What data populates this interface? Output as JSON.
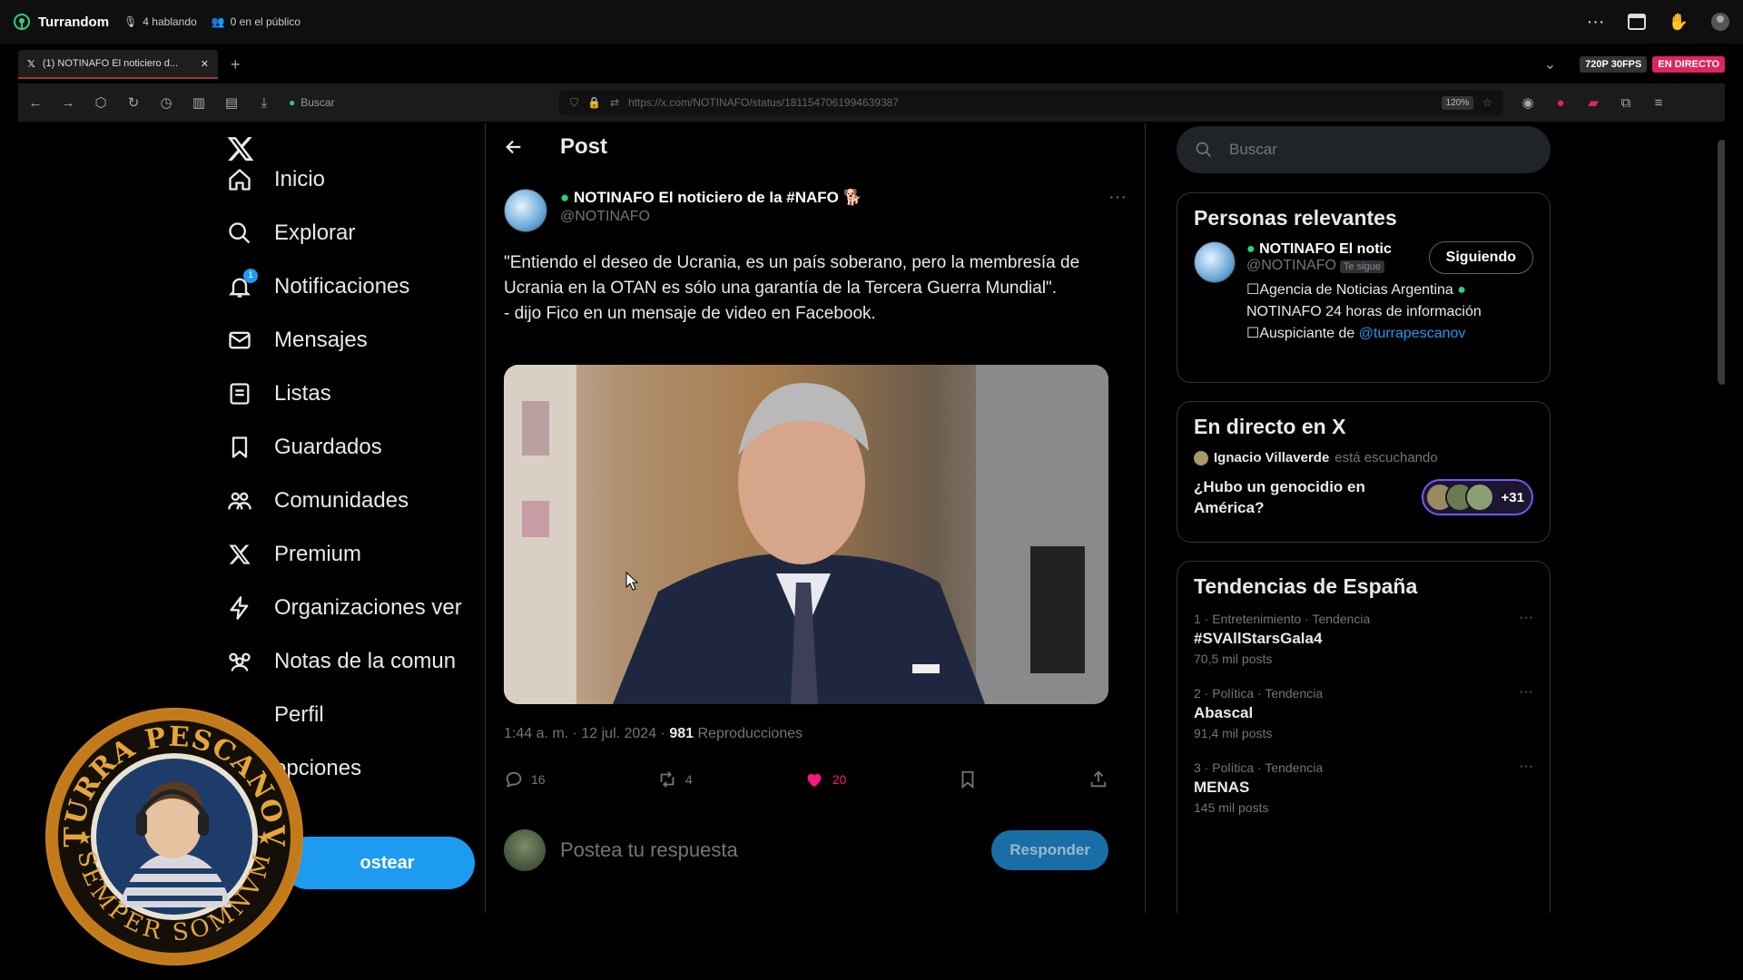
{
  "topbar": {
    "app_name": "Turrandom",
    "speaking": "4 hablando",
    "audience": "0 en el público"
  },
  "browser": {
    "tab_title": "(1) NOTINAFO El noticiero d...",
    "quality_badge": "720P 30FPS",
    "live_badge": "EN DIRECTO",
    "search_placeholder": "Buscar",
    "url": "https://x.com/NOTINAFO/status/1811547061994639387",
    "zoom": "120%"
  },
  "leftnav": {
    "items": [
      {
        "label": "Inicio",
        "icon": "home-icon"
      },
      {
        "label": "Explorar",
        "icon": "search-icon"
      },
      {
        "label": "Notificaciones",
        "icon": "bell-icon",
        "badge": "1"
      },
      {
        "label": "Mensajes",
        "icon": "mail-icon"
      },
      {
        "label": "Listas",
        "icon": "list-icon"
      },
      {
        "label": "Guardados",
        "icon": "bookmark-icon"
      },
      {
        "label": "Comunidades",
        "icon": "communities-icon"
      },
      {
        "label": "Premium",
        "icon": "x-logo-icon"
      },
      {
        "label": "Organizaciones ver",
        "icon": "lightning-icon"
      },
      {
        "label": "Notas de la comun",
        "icon": "notes-icon"
      },
      {
        "label": "Perfil",
        "icon": "profile-icon"
      },
      {
        "label": "opciones",
        "icon": "more-options-icon"
      }
    ],
    "post_button": "ostear"
  },
  "stream_overlay": {
    "top_text": "TURRA PESCANOV",
    "bottom_text": "SEMPER SOMNVM"
  },
  "post": {
    "header": "Post",
    "author_name": "NOTINAFO El noticiero de la #NAFO",
    "author_handle": "@NOTINAFO",
    "text_line1": "\"Entiendo el deseo de Ucrania, es un país soberano, pero la membresía de Ucrania en la OTAN es sólo una garantía de la Tercera Guerra Mundial\".",
    "text_line2": "- dijo Fico en un mensaje de video en Facebook.",
    "time": "1:44 a. m. · 12 jul. 2024 · ",
    "views_count": "981",
    "views_label": "Reproducciones",
    "replies": "16",
    "reposts": "4",
    "likes": "20",
    "reply_placeholder": "Postea tu respuesta",
    "reply_button": "Responder"
  },
  "right": {
    "search_placeholder": "Buscar",
    "relevant": {
      "title": "Personas relevantes",
      "name": "NOTINAFO El notic",
      "handle": "@NOTINAFO",
      "follows_you": "Te sigue",
      "follow_button": "Siguiendo",
      "bio_line1": "Agencia de Noticias Argentina",
      "bio_line2": "NOTINAFO 24 horas de información",
      "bio_line3_prefix": "Auspiciante de ",
      "bio_link": "@turrapescanov"
    },
    "live": {
      "title": "En directo en X",
      "host": "Ignacio Villaverde",
      "host_status": "está escuchando",
      "question": "¿Hubo un genocidio en América?",
      "listener_count": "+31"
    },
    "trends": {
      "title": "Tendencias de España",
      "items": [
        {
          "category": "1 · Entretenimiento · Tendencia",
          "name": "#SVAllStarsGala4",
          "count": "70,5 mil posts"
        },
        {
          "category": "2 · Política · Tendencia",
          "name": "Abascal",
          "count": "91,4 mil posts"
        },
        {
          "category": "3 · Política · Tendencia",
          "name": "MENAS",
          "count": "145 mil posts"
        }
      ]
    }
  },
  "colors": {
    "accent": "#1d9bf0",
    "like": "#f91880",
    "live_red": "#e0245e"
  }
}
